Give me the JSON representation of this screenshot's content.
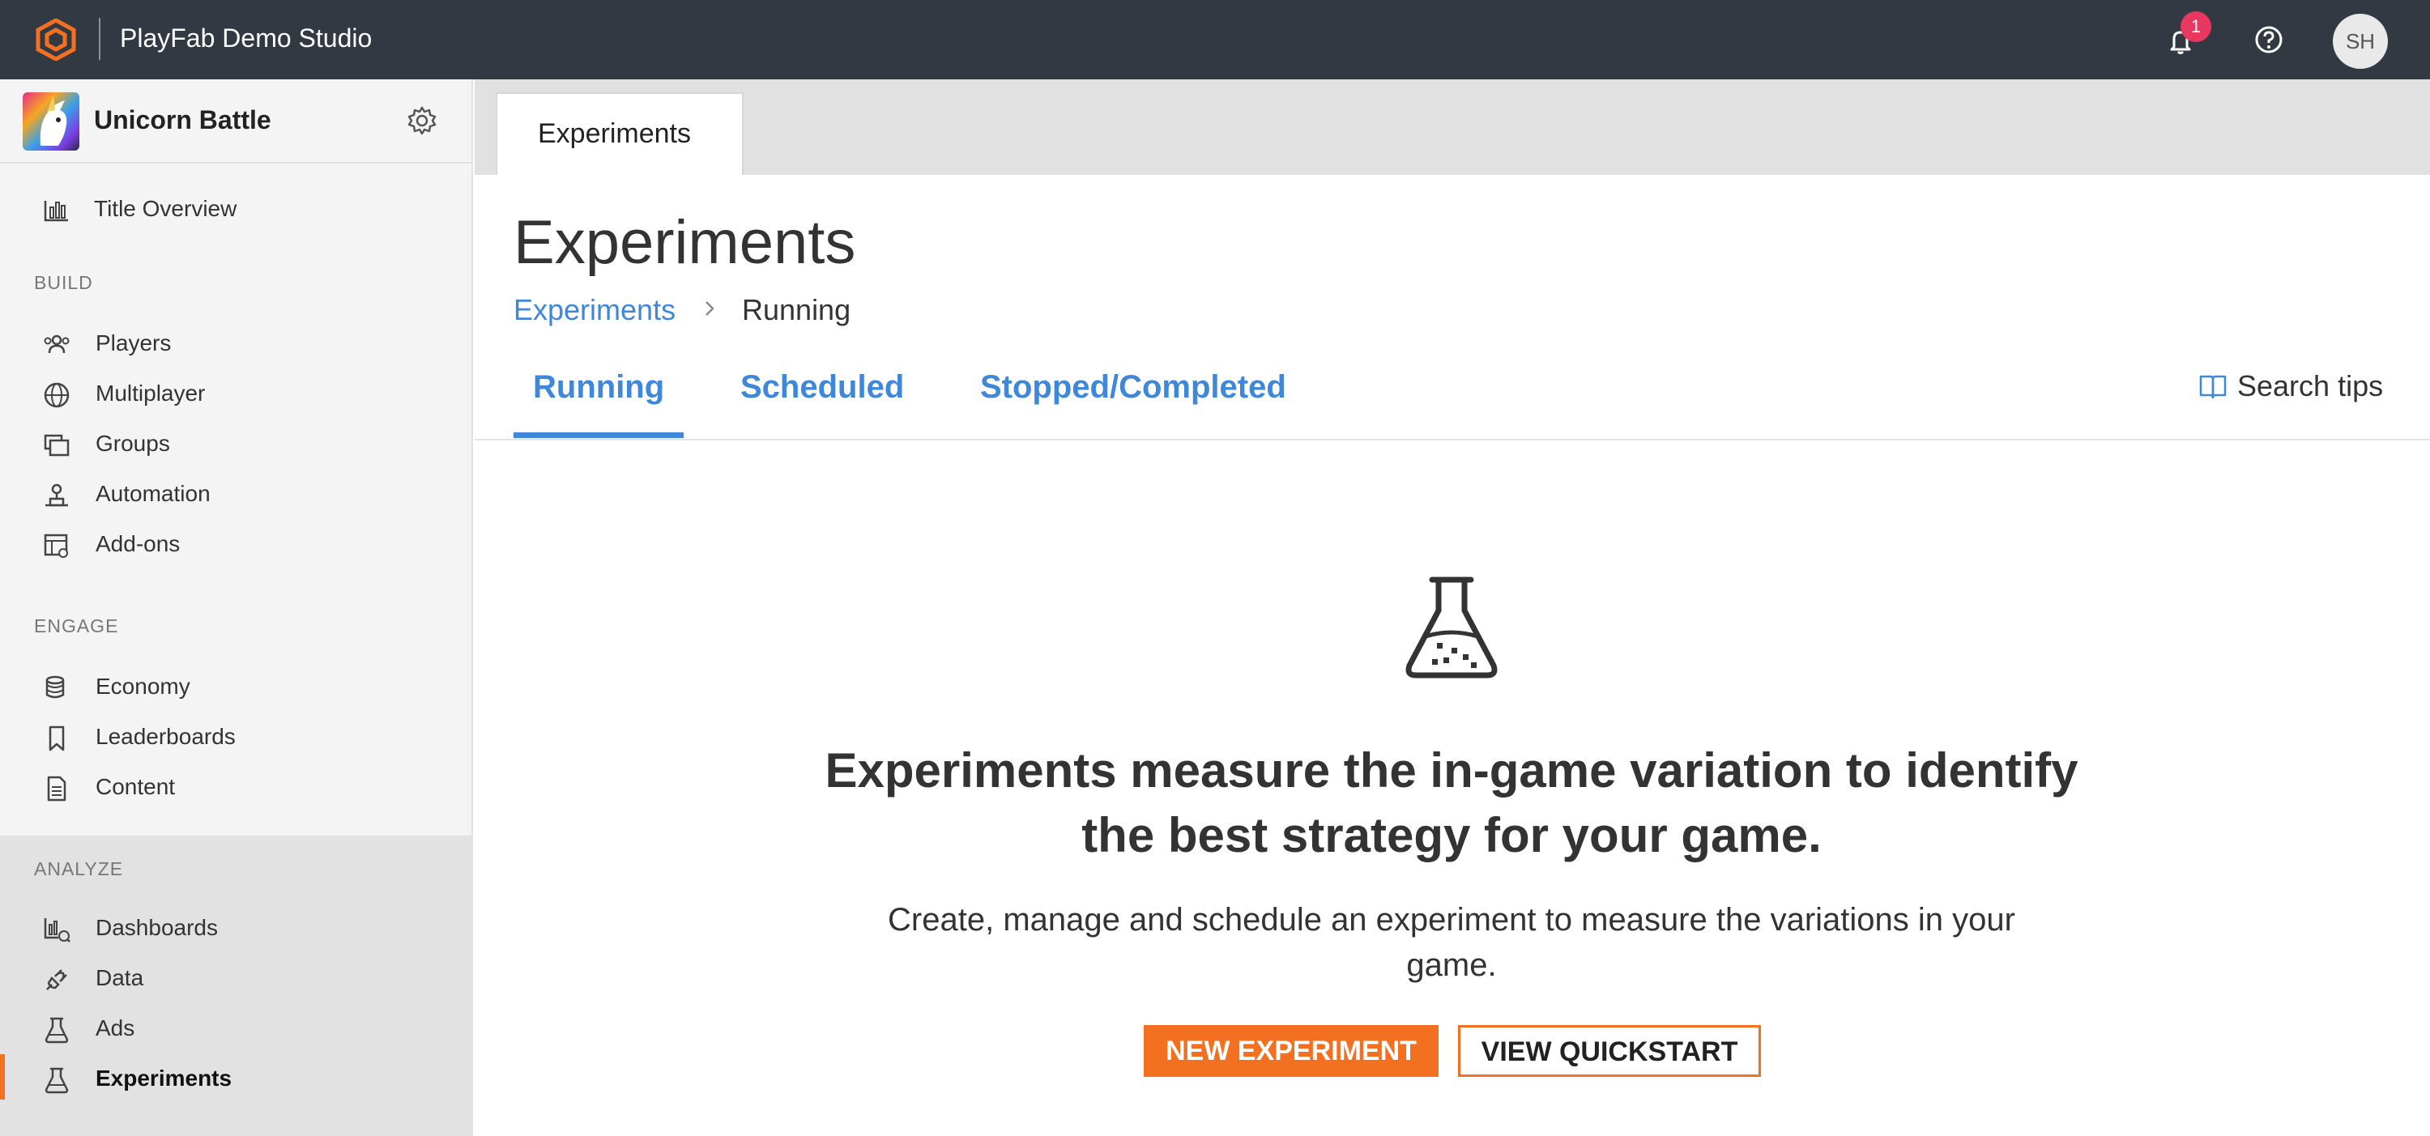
{
  "header": {
    "studio_name": "PlayFab Demo Studio",
    "notifications_count": "1",
    "avatar_initials": "SH"
  },
  "sidebar": {
    "title_name": "Unicorn Battle",
    "overview_label": "Title Overview",
    "sections": [
      {
        "label": "BUILD",
        "items": [
          "Players",
          "Multiplayer",
          "Groups",
          "Automation",
          "Add-ons"
        ]
      },
      {
        "label": "ENGAGE",
        "items": [
          "Economy",
          "Leaderboards",
          "Content"
        ]
      },
      {
        "label": "ANALYZE",
        "items": [
          "Dashboards",
          "Data",
          "Ads",
          "Experiments"
        ]
      }
    ],
    "active_item": "Experiments"
  },
  "page_tab": {
    "label": "Experiments"
  },
  "main": {
    "title": "Experiments",
    "breadcrumb": {
      "link": "Experiments",
      "current": "Running"
    },
    "tabs": [
      "Running",
      "Scheduled",
      "Stopped/Completed"
    ],
    "active_tab": "Running",
    "search_tips": "Search tips",
    "empty_state": {
      "headline": "Experiments measure the in-game variation to identify the best strategy for your game.",
      "description": "Create, manage and schedule an experiment to measure the variations in your game.",
      "primary_button": "NEW EXPERIMENT",
      "secondary_button": "VIEW QUICKSTART"
    }
  },
  "colors": {
    "topbar": "#323943",
    "accent_orange": "#f37021",
    "link_blue": "#3f87d8",
    "badge_red": "#e8385f"
  }
}
